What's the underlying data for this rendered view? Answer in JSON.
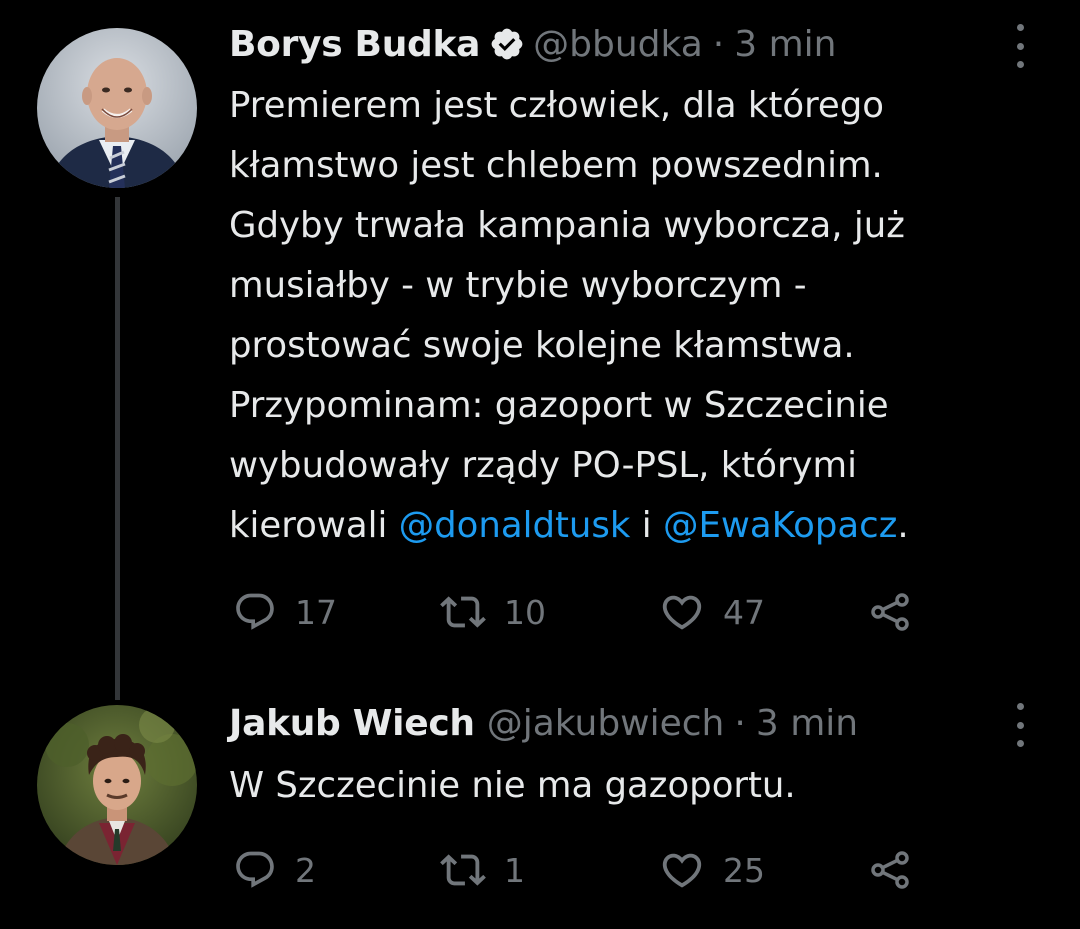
{
  "colors": {
    "background": "#000000",
    "text_primary": "#e7e9ea",
    "text_secondary": "#71767b",
    "link": "#1d9bf0",
    "thread_line": "#333639"
  },
  "tweets": [
    {
      "author": {
        "display_name": "Borys Budka",
        "verified": true,
        "verified_icon": "verified-badge-icon",
        "handle": "@bbudka",
        "separator": "·",
        "time": "3 min",
        "avatar": "avatar-photo-borys-budka"
      },
      "text": {
        "lines": [
          "Premierem jest człowiek, dla którego",
          "kłamstwo jest chlebem powszednim.",
          "Gdyby trwała kampania wyborcza, już",
          "musiałby - w trybie wyborczym -",
          "prostować swoje kolejne kłamstwa.",
          "Przypominam: gazoport w Szczecinie",
          "wybudowały rządy PO-PSL, którymi"
        ],
        "last_line_prefix": "kierowali ",
        "mention_1": "@donaldtusk",
        "connector": " i ",
        "mention_2": "@EwaKopacz",
        "last_line_suffix": "."
      },
      "actions": {
        "reply_count": "17",
        "retweet_count": "10",
        "like_count": "47"
      }
    },
    {
      "author": {
        "display_name": "Jakub Wiech",
        "handle": "@jakubwiech",
        "separator": "·",
        "time": "3 min",
        "avatar": "avatar-photo-jakub-wiech"
      },
      "text": {
        "lines": [
          "W Szczecinie nie ma gazoportu."
        ]
      },
      "actions": {
        "reply_count": "2",
        "retweet_count": "1",
        "like_count": "25"
      }
    }
  ]
}
